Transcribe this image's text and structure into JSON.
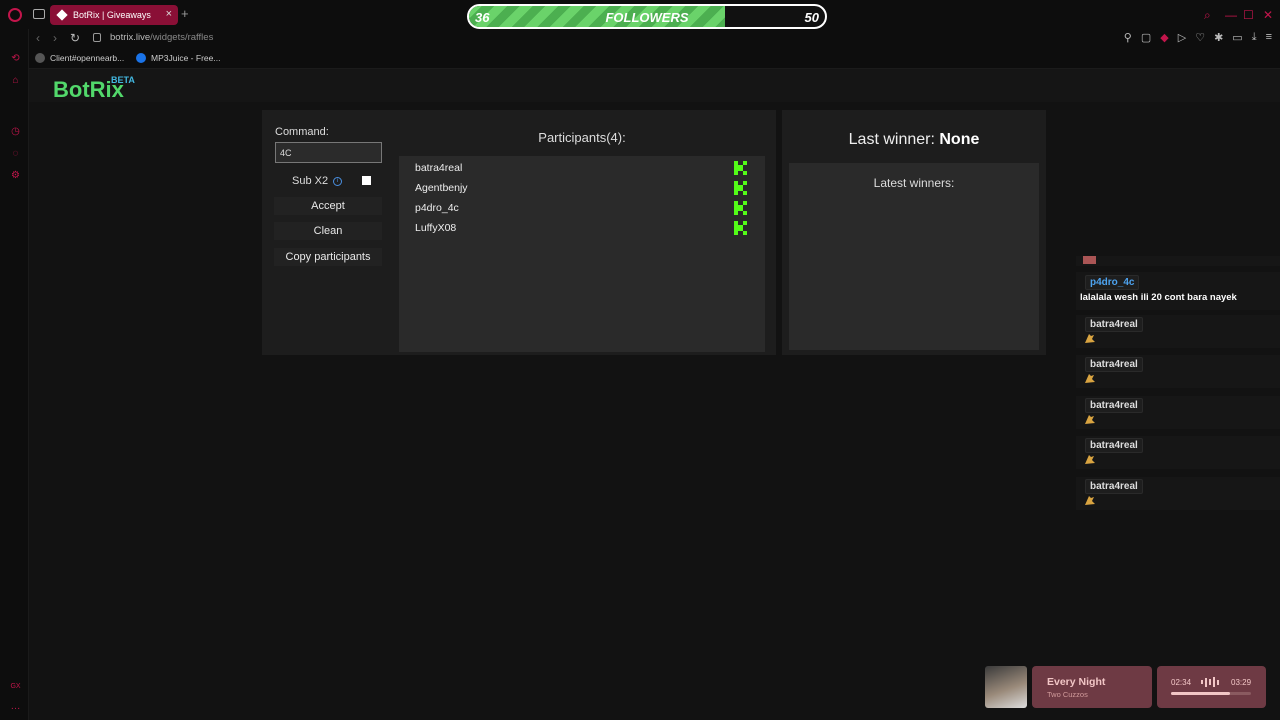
{
  "browser": {
    "tab_title": "BotRix | Giveaways",
    "new_tab_symbol": "+",
    "close_tab_symbol": "×",
    "url_host": "botrix.live",
    "url_path": "/widgets/raffles",
    "bookmarks": [
      "Client#opennearb...",
      "MP3Juice - Free..."
    ],
    "accent_color": "#c2154b"
  },
  "followers_widget": {
    "label": "FOLLOWERS",
    "current": "36",
    "goal": "50",
    "progress": 0.72
  },
  "app": {
    "logo": "BotRix",
    "logo_badge": "BETA",
    "brand_color": "#52d86b"
  },
  "raffle": {
    "command_label": "Command:",
    "command_value": "4C",
    "sub_label": "Sub X2",
    "info_symbol": "i",
    "buttons": {
      "accept": "Accept",
      "clean": "Clean",
      "copy": "Copy participants"
    },
    "participants_title": "Participants(4):",
    "participants": [
      "batra4real",
      "Agentbenjy",
      "p4dro_4c",
      "LuffyX08"
    ]
  },
  "winners": {
    "last_winner_label": "Last winner:",
    "last_winner_value": "None",
    "latest_label": "Latest winners:"
  },
  "chat": {
    "first_user": "p4dro_4c",
    "first_message": "lalalala wesh ili 20 cont bara nayek",
    "repeat_user": "batra4real"
  },
  "music": {
    "title": "Every Night",
    "artist": "Two Cuzzos",
    "elapsed": "02:34",
    "total": "03:29",
    "progress": 0.74
  }
}
